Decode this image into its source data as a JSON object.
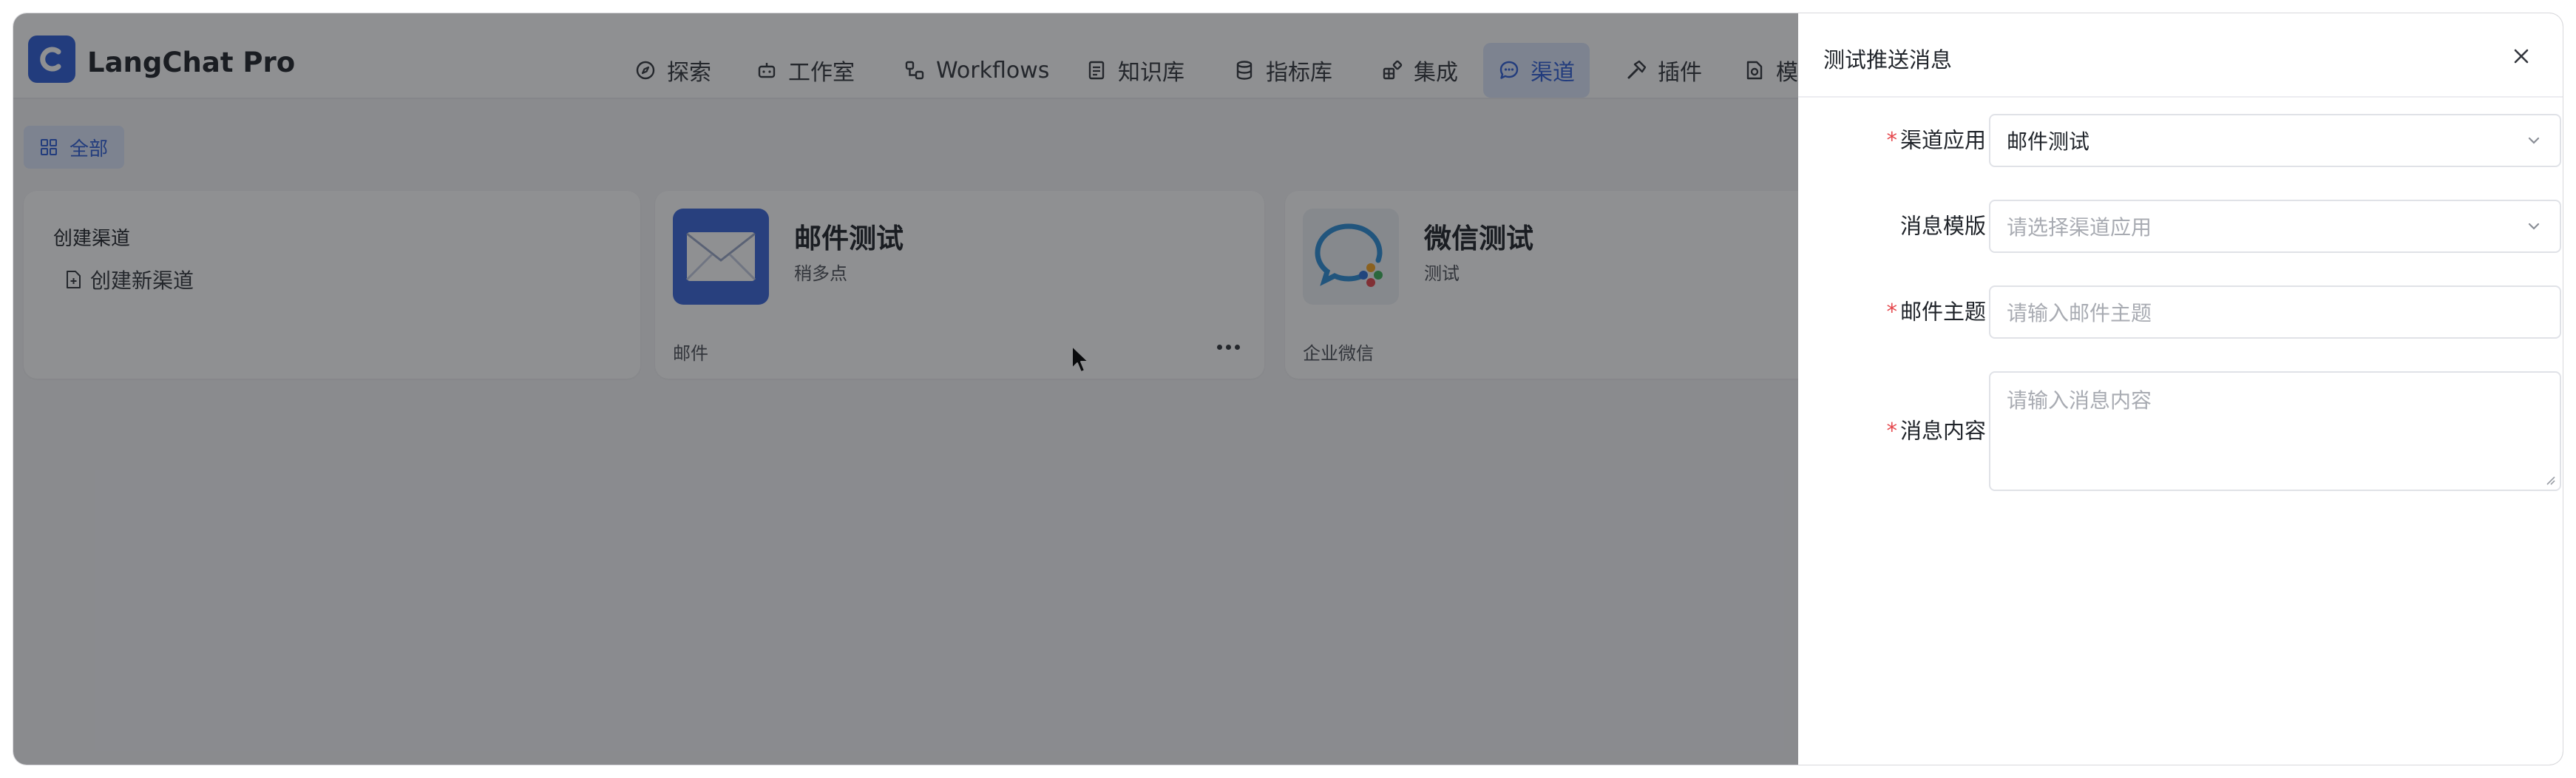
{
  "app": {
    "title": "LangChat Pro"
  },
  "nav": {
    "items": [
      {
        "label": "探索",
        "icon": "compass-icon"
      },
      {
        "label": "工作室",
        "icon": "robot-icon"
      },
      {
        "label": "Workflows",
        "icon": "workflow-icon"
      },
      {
        "label": "知识库",
        "icon": "document-icon"
      },
      {
        "label": "指标库",
        "icon": "database-icon"
      },
      {
        "label": "集成",
        "icon": "blocks-icon"
      },
      {
        "label": "渠道",
        "icon": "chat-bubble-icon",
        "active": true
      },
      {
        "label": "插件",
        "icon": "hammer-icon"
      },
      {
        "label": "模型",
        "icon": "model-icon"
      }
    ]
  },
  "filter": {
    "label": "全部"
  },
  "cards": {
    "create": {
      "title": "创建渠道",
      "link": "创建新渠道"
    },
    "mail": {
      "name": "邮件测试",
      "desc": "稍多点",
      "type": "邮件"
    },
    "wx": {
      "name": "微信测试",
      "desc": "测试",
      "type": "企业微信"
    }
  },
  "drawer": {
    "title": "测试推送消息",
    "fields": {
      "channel_app": {
        "label": "渠道应用",
        "required": true,
        "value": "邮件测试"
      },
      "template": {
        "label": "消息模版",
        "required": false,
        "placeholder": "请选择渠道应用"
      },
      "subject": {
        "label": "邮件主题",
        "required": true,
        "placeholder": "请输入邮件主题"
      },
      "content": {
        "label": "消息内容",
        "required": true,
        "placeholder": "请输入消息内容"
      }
    }
  },
  "colors": {
    "accent": "#2e5fd6",
    "required": "#e5484d",
    "overlay": "rgba(20,22,28,0.48)"
  }
}
